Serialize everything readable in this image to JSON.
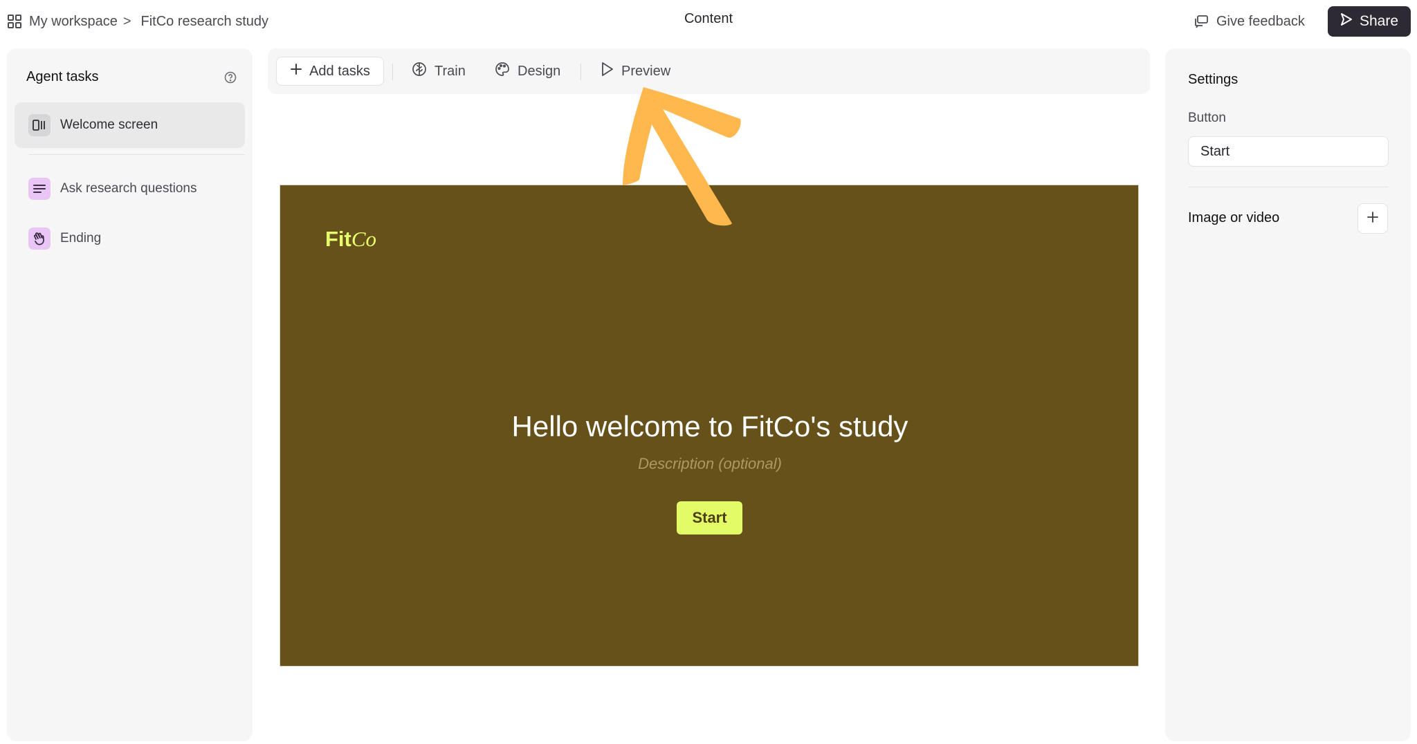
{
  "breadcrumb": {
    "workspace": "My workspace",
    "separator": ">",
    "project": "FitCo research study"
  },
  "header": {
    "title": "Content",
    "feedback_label": "Give feedback",
    "share_label": "Share"
  },
  "sidebar": {
    "title": "Agent tasks",
    "items": [
      {
        "label": "Welcome screen",
        "icon": "welcome-screen-icon",
        "active": true
      },
      {
        "label": "Ask research questions",
        "icon": "list-lines-icon"
      },
      {
        "label": "Ending",
        "icon": "wave-hand-icon"
      }
    ]
  },
  "toolbar": {
    "add_tasks": "Add tasks",
    "train": "Train",
    "design": "Design",
    "preview": "Preview"
  },
  "preview_screen": {
    "logo_fit": "Fit",
    "logo_co": "Co",
    "title": "Hello welcome to FitCo's study",
    "description_placeholder": "Description (optional)",
    "start_label": "Start",
    "background_color": "#66511b",
    "accent_color": "#e2fb66"
  },
  "settings": {
    "title": "Settings",
    "button_label": "Button",
    "button_value": "Start",
    "media_label": "Image or video"
  },
  "colors": {
    "annotation_arrow": "#ffb84d",
    "share_button": "#2e2a33"
  }
}
